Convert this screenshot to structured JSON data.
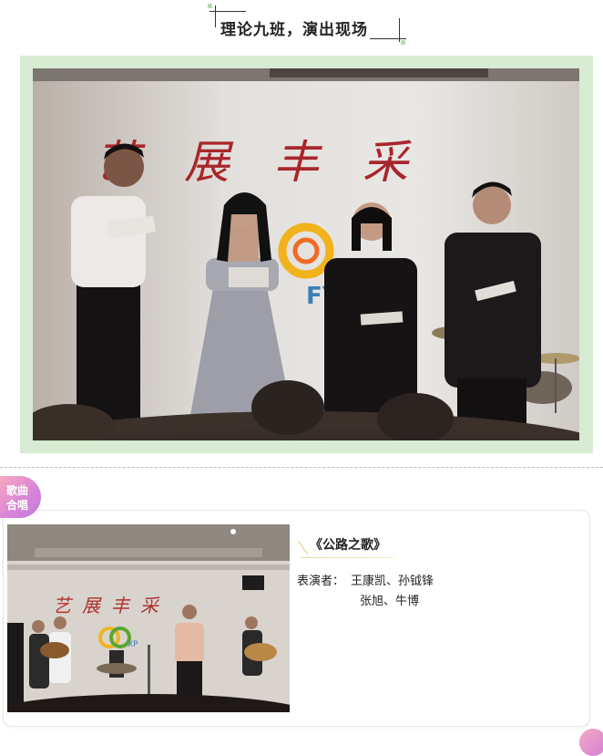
{
  "header": {
    "title": "理论九班，演出现场",
    "accent_color": "#bcd9b7"
  },
  "main_photo": {
    "frame_color": "#d7ecd2",
    "banner_text": "艺展丰采",
    "logo_text": "FY"
  },
  "section_badge": {
    "line1": "歌曲",
    "line2": "合唱",
    "colors": [
      "#f7a7c0",
      "#c079e0"
    ]
  },
  "song": {
    "title": "《公路之歌》",
    "performers_label": "表演者：",
    "performers_line1": "王康凯、孙钺锋",
    "performers_line2": "张旭、牛博",
    "photo_banner": "艺展丰采",
    "photo_logo": "XP"
  }
}
